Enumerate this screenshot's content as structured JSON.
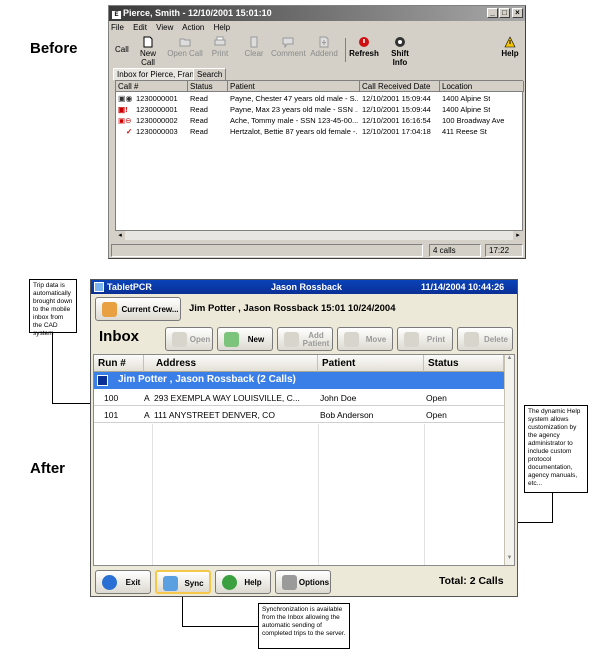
{
  "labels": {
    "before": "Before",
    "after": "After"
  },
  "before": {
    "title": "Pierce, Smith - 12/10/2001 15:01:10",
    "title_icon": "ems",
    "menu": [
      "File",
      "Edit",
      "View",
      "Action",
      "Help"
    ],
    "toolbar": {
      "call": "Call",
      "new_call": "New Call",
      "open_call": "Open Call",
      "print": "Print",
      "clear": "Clear",
      "comment": "Comment",
      "addend": "Addend",
      "refresh": "Refresh",
      "shift_info": "Shift Info",
      "help": "Help"
    },
    "tabs": [
      "Inbox for Pierce, Frank",
      "Search"
    ],
    "columns": [
      "Call #",
      "Status",
      "Patient",
      "Call Received Date",
      "Location"
    ],
    "rows": [
      {
        "call": "1230000001",
        "status": "Read",
        "patient": "Payne, Chester  47 years old male - S...",
        "date": "12/10/2001 15:09:44",
        "location": "1400 Alpine St"
      },
      {
        "call": "1230000001",
        "status": "Read",
        "patient": "Payne, Max  23 years old male - SSN ...",
        "date": "12/10/2001 15:09:44",
        "location": "1400 Alpine St"
      },
      {
        "call": "1230000002",
        "status": "Read",
        "patient": "Ache, Tommy   male - SSN 123-45-00...",
        "date": "12/10/2001 16:16:54",
        "location": "100 Broadway Ave"
      },
      {
        "call": "1230000003",
        "status": "Read",
        "patient": "Hertzalot, Bettie  87 years old female -...",
        "date": "12/10/2001 17:04:18",
        "location": "411 Reese St"
      }
    ],
    "status_bar": {
      "count": "4 calls",
      "time": "17:22"
    }
  },
  "callouts": {
    "trip": "Trip data is automatically brought down to the mobile inbox from the CAD system",
    "help": "The dynamic Help system allows customization by the agency administrator to include custom protocol documentation, agency manuals, etc...",
    "sync": "Synchronization is available from the Inbox allowing the automatic sending of completed trips to the server."
  },
  "after": {
    "app_name": "TabletPCR",
    "user": "Jason Rossback",
    "datetime": "11/14/2004  10:44:26",
    "current_crew_button": "Current Crew...",
    "crew_info": "Jim Potter , Jason Rossback  15:01 10/24/2004",
    "inbox_title": "Inbox",
    "toolbar": {
      "open": "Open",
      "new": "New",
      "add_patient": "Add Patient",
      "move": "Move",
      "print": "Print",
      "delete": "Delete"
    },
    "columns": [
      "Run #",
      "Address",
      "Patient",
      "Status"
    ],
    "group_label": "Jim Potter ,  Jason Rossback  (2  Calls)",
    "rows": [
      {
        "run": "100",
        "flag": "A",
        "address": "293 EXEMPLA WAY LOUISVILLE, C...",
        "patient": "John Doe",
        "status": "Open"
      },
      {
        "run": "101",
        "flag": "A",
        "address": "111 ANYSTREET DENVER, CO",
        "patient": "Bob Anderson",
        "status": "Open"
      }
    ],
    "bottom": {
      "exit": "Exit",
      "sync": "Sync",
      "help": "Help",
      "options": "Options",
      "total": "Total: 2 Calls"
    },
    "colors": {
      "title_bar": "#0a43b8",
      "group_row": "#3a7ee8",
      "sync_highlight": "#f5c84a"
    }
  }
}
